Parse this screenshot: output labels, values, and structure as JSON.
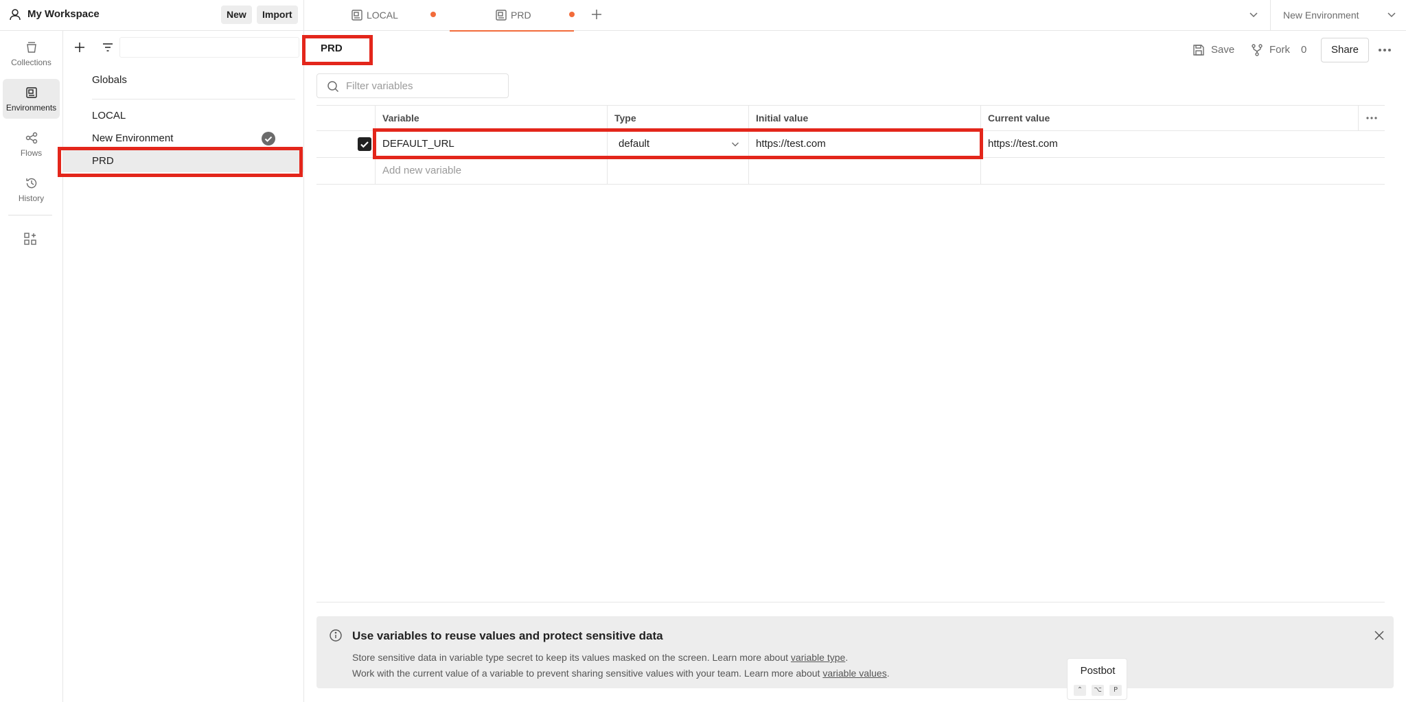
{
  "workspace": {
    "name": "My Workspace",
    "new_label": "New",
    "import_label": "Import"
  },
  "tabs": [
    {
      "label": "LOCAL",
      "unsaved": true,
      "active": false
    },
    {
      "label": "PRD",
      "unsaved": true,
      "active": true
    }
  ],
  "env_selector": {
    "label": "New Environment"
  },
  "rail": [
    {
      "label": "Collections",
      "icon": "collections-icon",
      "active": false
    },
    {
      "label": "Environments",
      "icon": "environments-icon",
      "active": true
    },
    {
      "label": "Flows",
      "icon": "flows-icon",
      "active": false
    },
    {
      "label": "History",
      "icon": "history-icon",
      "active": false
    }
  ],
  "sidebar": {
    "globals": "Globals",
    "environments": [
      {
        "label": "LOCAL",
        "active": false,
        "selected": false
      },
      {
        "label": "New Environment",
        "active": true,
        "selected": false
      },
      {
        "label": "PRD",
        "active": false,
        "selected": true
      }
    ]
  },
  "main": {
    "title": "PRD",
    "save_label": "Save",
    "fork_label": "Fork",
    "fork_count": "0",
    "share_label": "Share",
    "filter_placeholder": "Filter variables",
    "columns": [
      "Variable",
      "Type",
      "Initial value",
      "Current value"
    ],
    "variables": [
      {
        "enabled": true,
        "name": "DEFAULT_URL",
        "type": "default",
        "initial": "https://test.com",
        "current": "https://test.com"
      }
    ],
    "add_placeholder": "Add new variable"
  },
  "banner": {
    "title": "Use variables to reuse values and protect sensitive data",
    "line1_text": "Store sensitive data in variable type secret to keep its values masked on the screen. Learn more about ",
    "line1_link": "variable type",
    "line1_end": ".",
    "line2_text": "Work with the current value of a variable to prevent sharing sensitive values with your team. Learn more about ",
    "line2_link": "variable values",
    "line2_end": "."
  },
  "postbot": {
    "label": "Postbot",
    "keys": [
      "⌃",
      "⌥",
      "P"
    ]
  },
  "colors": {
    "accent": "#f26b3a",
    "highlight": "#e3261b",
    "selected_bg": "#ebebeb"
  }
}
